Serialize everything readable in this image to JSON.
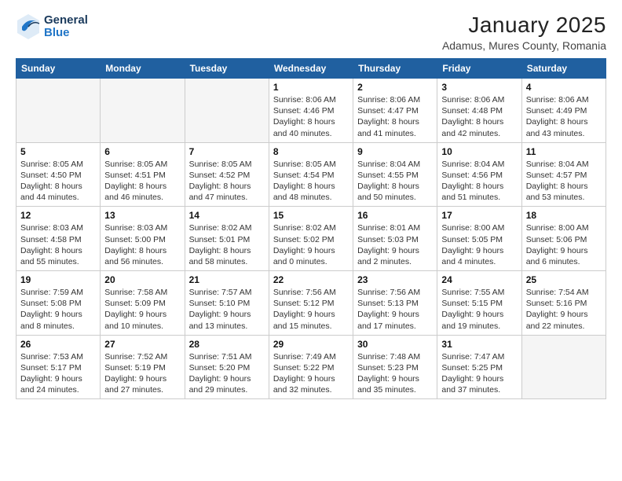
{
  "logo": {
    "general": "General",
    "blue": "Blue"
  },
  "header": {
    "month": "January 2025",
    "location": "Adamus, Mures County, Romania"
  },
  "weekdays": [
    "Sunday",
    "Monday",
    "Tuesday",
    "Wednesday",
    "Thursday",
    "Friday",
    "Saturday"
  ],
  "weeks": [
    [
      {
        "day": null
      },
      {
        "day": null
      },
      {
        "day": null
      },
      {
        "day": "1",
        "sunrise": "8:06 AM",
        "sunset": "4:46 PM",
        "daylight": "8 hours and 40 minutes."
      },
      {
        "day": "2",
        "sunrise": "8:06 AM",
        "sunset": "4:47 PM",
        "daylight": "8 hours and 41 minutes."
      },
      {
        "day": "3",
        "sunrise": "8:06 AM",
        "sunset": "4:48 PM",
        "daylight": "8 hours and 42 minutes."
      },
      {
        "day": "4",
        "sunrise": "8:06 AM",
        "sunset": "4:49 PM",
        "daylight": "8 hours and 43 minutes."
      }
    ],
    [
      {
        "day": "5",
        "sunrise": "8:05 AM",
        "sunset": "4:50 PM",
        "daylight": "8 hours and 44 minutes."
      },
      {
        "day": "6",
        "sunrise": "8:05 AM",
        "sunset": "4:51 PM",
        "daylight": "8 hours and 46 minutes."
      },
      {
        "day": "7",
        "sunrise": "8:05 AM",
        "sunset": "4:52 PM",
        "daylight": "8 hours and 47 minutes."
      },
      {
        "day": "8",
        "sunrise": "8:05 AM",
        "sunset": "4:54 PM",
        "daylight": "8 hours and 48 minutes."
      },
      {
        "day": "9",
        "sunrise": "8:04 AM",
        "sunset": "4:55 PM",
        "daylight": "8 hours and 50 minutes."
      },
      {
        "day": "10",
        "sunrise": "8:04 AM",
        "sunset": "4:56 PM",
        "daylight": "8 hours and 51 minutes."
      },
      {
        "day": "11",
        "sunrise": "8:04 AM",
        "sunset": "4:57 PM",
        "daylight": "8 hours and 53 minutes."
      }
    ],
    [
      {
        "day": "12",
        "sunrise": "8:03 AM",
        "sunset": "4:58 PM",
        "daylight": "8 hours and 55 minutes."
      },
      {
        "day": "13",
        "sunrise": "8:03 AM",
        "sunset": "5:00 PM",
        "daylight": "8 hours and 56 minutes."
      },
      {
        "day": "14",
        "sunrise": "8:02 AM",
        "sunset": "5:01 PM",
        "daylight": "8 hours and 58 minutes."
      },
      {
        "day": "15",
        "sunrise": "8:02 AM",
        "sunset": "5:02 PM",
        "daylight": "9 hours and 0 minutes."
      },
      {
        "day": "16",
        "sunrise": "8:01 AM",
        "sunset": "5:03 PM",
        "daylight": "9 hours and 2 minutes."
      },
      {
        "day": "17",
        "sunrise": "8:00 AM",
        "sunset": "5:05 PM",
        "daylight": "9 hours and 4 minutes."
      },
      {
        "day": "18",
        "sunrise": "8:00 AM",
        "sunset": "5:06 PM",
        "daylight": "9 hours and 6 minutes."
      }
    ],
    [
      {
        "day": "19",
        "sunrise": "7:59 AM",
        "sunset": "5:08 PM",
        "daylight": "9 hours and 8 minutes."
      },
      {
        "day": "20",
        "sunrise": "7:58 AM",
        "sunset": "5:09 PM",
        "daylight": "9 hours and 10 minutes."
      },
      {
        "day": "21",
        "sunrise": "7:57 AM",
        "sunset": "5:10 PM",
        "daylight": "9 hours and 13 minutes."
      },
      {
        "day": "22",
        "sunrise": "7:56 AM",
        "sunset": "5:12 PM",
        "daylight": "9 hours and 15 minutes."
      },
      {
        "day": "23",
        "sunrise": "7:56 AM",
        "sunset": "5:13 PM",
        "daylight": "9 hours and 17 minutes."
      },
      {
        "day": "24",
        "sunrise": "7:55 AM",
        "sunset": "5:15 PM",
        "daylight": "9 hours and 19 minutes."
      },
      {
        "day": "25",
        "sunrise": "7:54 AM",
        "sunset": "5:16 PM",
        "daylight": "9 hours and 22 minutes."
      }
    ],
    [
      {
        "day": "26",
        "sunrise": "7:53 AM",
        "sunset": "5:17 PM",
        "daylight": "9 hours and 24 minutes."
      },
      {
        "day": "27",
        "sunrise": "7:52 AM",
        "sunset": "5:19 PM",
        "daylight": "9 hours and 27 minutes."
      },
      {
        "day": "28",
        "sunrise": "7:51 AM",
        "sunset": "5:20 PM",
        "daylight": "9 hours and 29 minutes."
      },
      {
        "day": "29",
        "sunrise": "7:49 AM",
        "sunset": "5:22 PM",
        "daylight": "9 hours and 32 minutes."
      },
      {
        "day": "30",
        "sunrise": "7:48 AM",
        "sunset": "5:23 PM",
        "daylight": "9 hours and 35 minutes."
      },
      {
        "day": "31",
        "sunrise": "7:47 AM",
        "sunset": "5:25 PM",
        "daylight": "9 hours and 37 minutes."
      },
      {
        "day": null
      }
    ]
  ]
}
